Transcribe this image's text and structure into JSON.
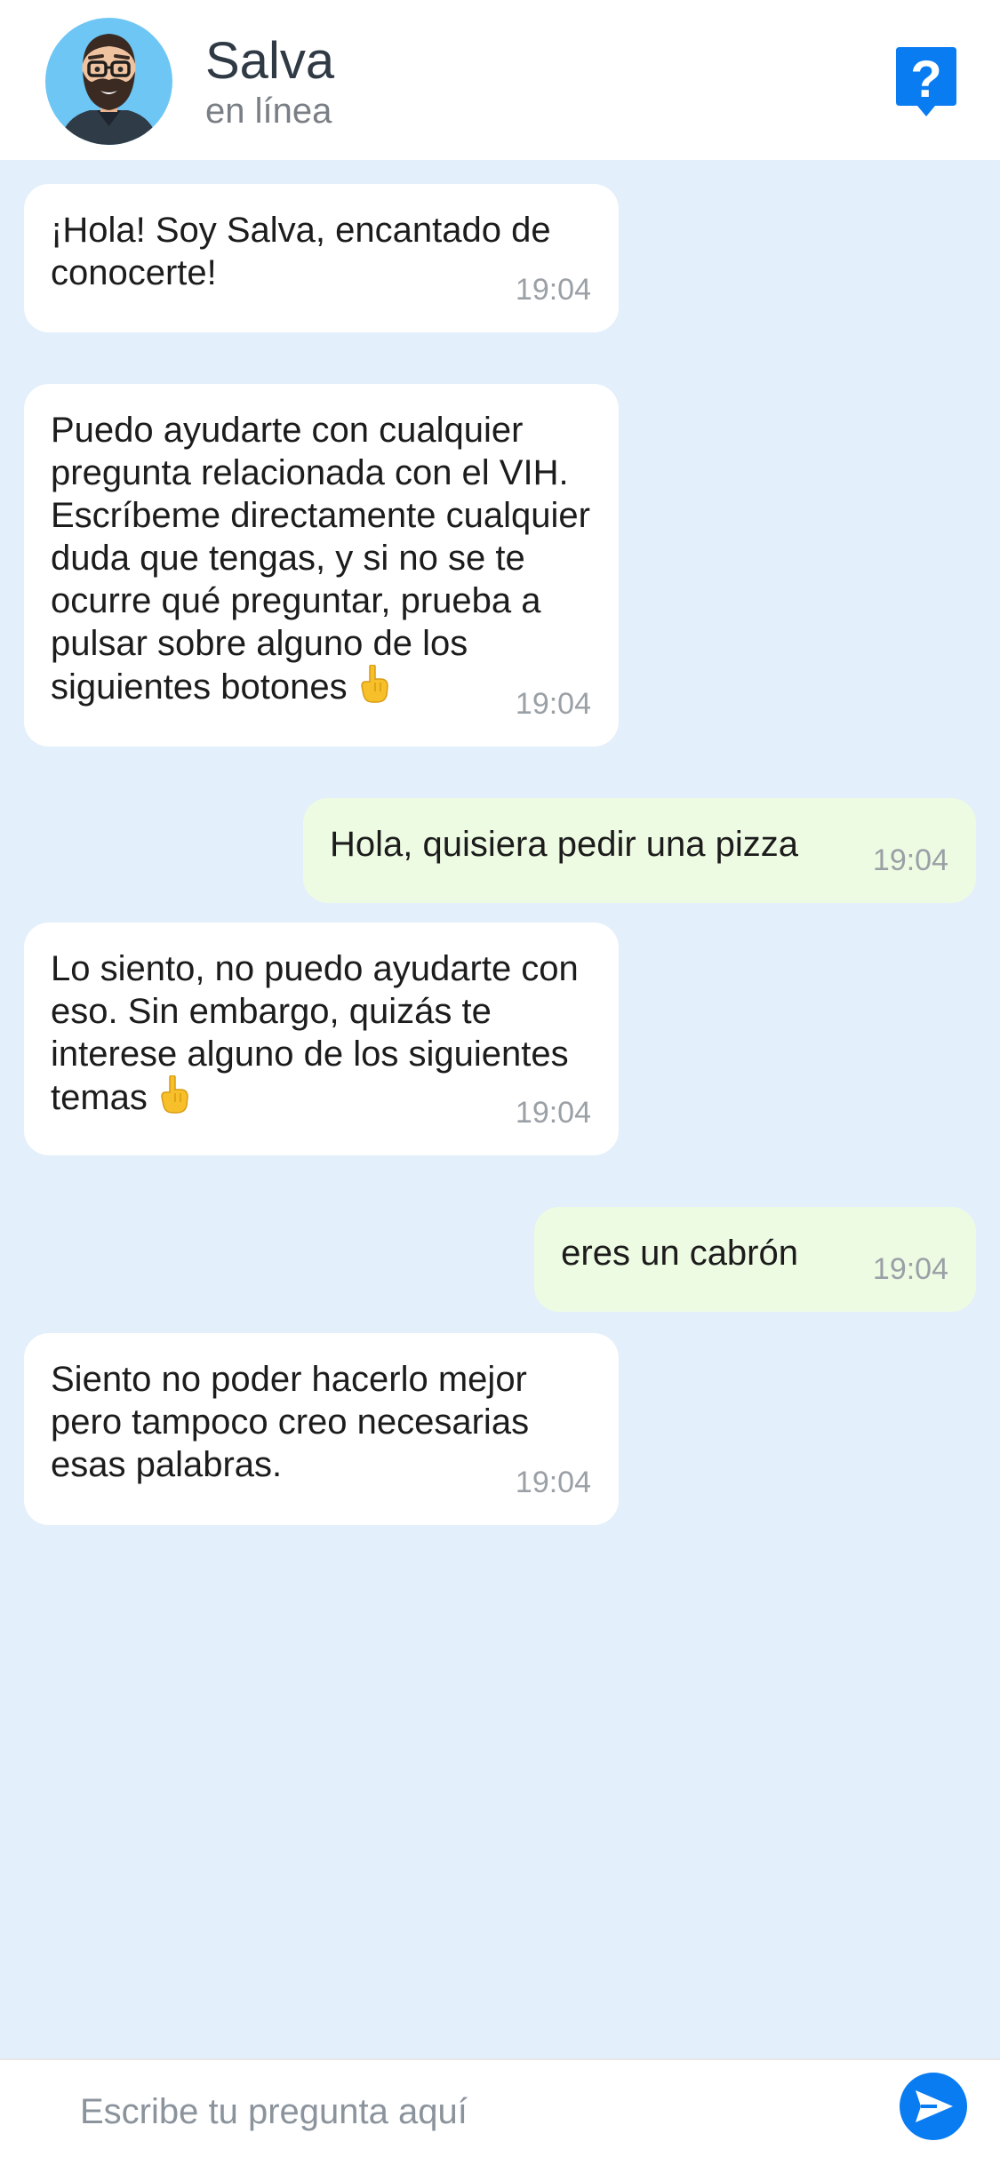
{
  "header": {
    "name": "Salva",
    "status": "en línea",
    "avatar_icon": "bearded-man-avatar-icon",
    "help_icon": "question-bubble-icon"
  },
  "messages": [
    {
      "direction": "incoming",
      "text": "¡Hola! Soy Salva, encantado de conocerte!",
      "time": "19:04"
    },
    {
      "direction": "incoming",
      "text": "Puedo ayudarte con cualquier pregunta relacionada con el VIH. Escríbeme directamente cualquier duda que tengas, y si no se te ocurre qué preguntar, prueba a pulsar sobre alguno de los siguientes botones",
      "time": "19:04",
      "emoji": "point-down-emoji"
    },
    {
      "direction": "outgoing",
      "text": "Hola, quisiera pedir una pizza",
      "time": "19:04"
    },
    {
      "direction": "incoming",
      "text": "Lo siento, no puedo ayudarte con eso. Sin embargo, quizás te interese alguno de los siguientes temas",
      "time": "19:04",
      "emoji": "point-down-emoji"
    },
    {
      "direction": "outgoing",
      "text": "eres un cabrón",
      "time": "19:04"
    },
    {
      "direction": "incoming",
      "text": "Siento no poder hacerlo mejor pero tampoco creo necesarias esas palabras.",
      "time": "19:04"
    }
  ],
  "composer": {
    "placeholder": "Escribe tu pregunta aquí",
    "value": "",
    "send_icon": "send-icon"
  },
  "colors": {
    "chat_background": "#e3effa",
    "incoming_bubble": "#ffffff",
    "outgoing_bubble": "#eefbe3",
    "accent": "#0a7cf2",
    "timestamp": "#9aa0a6"
  }
}
